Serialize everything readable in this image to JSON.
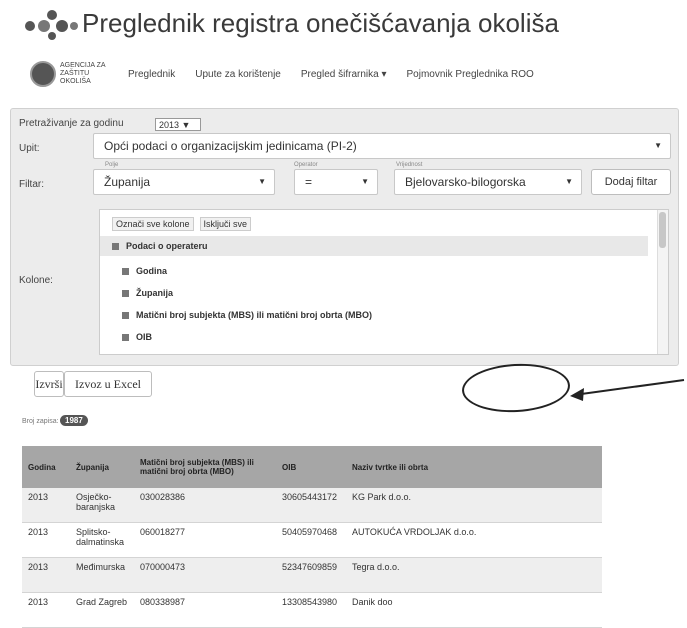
{
  "header": {
    "title": "Preglednik registra onečišćavanja okoliša",
    "agency_name_line1": "AGENCIJA ZA",
    "agency_name_line2": "ZAŠTITU OKOLIŠA",
    "nav": [
      "Preglednik",
      "Upute za korištenje",
      "Pregled šifrarnika ▾",
      "Pojmovnik Preglednika ROO"
    ]
  },
  "query": {
    "year_label": "Pretraživanje za godinu",
    "year_value": "2013 ▼",
    "upit_label": "Upit:",
    "upit_value": "Opći podaci o organizacijskim jedinicama (PI-2)",
    "filtar_label": "Filtar:",
    "polje_label": "Polje",
    "polje_value": "Županija",
    "operator_label": "Operator",
    "operator_value": "=",
    "vrijednost_label": "Vrijednost",
    "vrijednost_value": "Bjelovarsko-bilogorska",
    "add_filter_label": "Dodaj filtar",
    "kolone_label": "Kolone:",
    "select_all_label": "Označi sve kolone",
    "deselect_all_label": "Isključi sve",
    "group_label": "Podaci o operateru",
    "columns": [
      "Godina",
      "Županija",
      "Matični broj subjekta (MBS) ili matični broj obrta (MBO)",
      "OIB"
    ]
  },
  "actions": {
    "run_label": "Izvrši",
    "export_label": "Izvoz u Excel"
  },
  "results": {
    "count_label": "Broj zapisa:",
    "count_value": "1987",
    "headers": [
      "Godina",
      "Županija",
      "Matični broj subjekta (MBS) ili matični broj obrta (MBO)",
      "OIB",
      "Naziv tvrtke ili obrta"
    ],
    "rows": [
      [
        "2013",
        "Osječko-baranjska",
        "030028386",
        "30605443172",
        "KG Park d.o.o."
      ],
      [
        "2013",
        "Splitsko-dalmatinska",
        "060018277",
        "50405970468",
        "AUTOKUĆA VRDOLJAK d.o.o."
      ],
      [
        "2013",
        "Međimurska",
        "070000473",
        "52347609859",
        "Tegra d.o.o."
      ],
      [
        "2013",
        "Grad Zagreb",
        "080338987",
        "13308543980",
        "Danik doo"
      ]
    ]
  }
}
